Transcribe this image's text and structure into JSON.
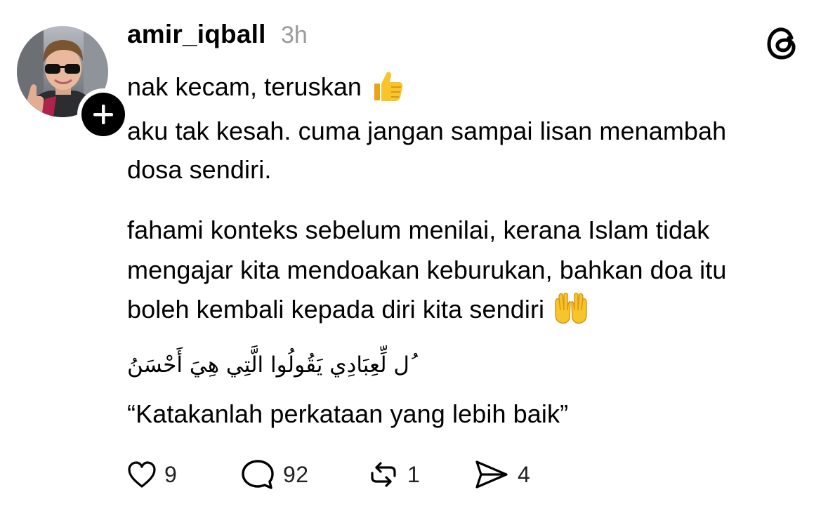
{
  "post": {
    "username": "amir_iqball",
    "timestamp": "3h",
    "lines": [
      "nak kecam, teruskan",
      "aku tak kesah. cuma jangan sampai lisan menambah",
      "dosa sendiri.",
      "fahami konteks sebelum menilai, kerana Islam tidak",
      "mengajar kita mendoakan keburukan, bahkan doa itu",
      "boleh kembali kepada diri kita sendiri",
      "ُل لِّعِبَادِي يَقُولُوا الَّتِي هِيَ أَحْسَنُ",
      "“Katakanlah perkataan yang lebih baik”"
    ]
  },
  "actions": {
    "likes": "9",
    "replies": "92",
    "reposts": "1",
    "shares": "4"
  },
  "icons": {
    "avatar": "profile-photo",
    "follow": "plus-icon",
    "brand": "threads-logo-icon",
    "thumbs_up": "thumbs-up-emoji",
    "open_hands": "palms-up-emoji",
    "like": "heart-icon",
    "reply": "comment-bubble-icon",
    "repost": "repost-icon",
    "share": "send-icon"
  },
  "colors": {
    "text": "#000000",
    "muted": "#9a9a9a",
    "emoji_yellow": "#f7c52b"
  }
}
